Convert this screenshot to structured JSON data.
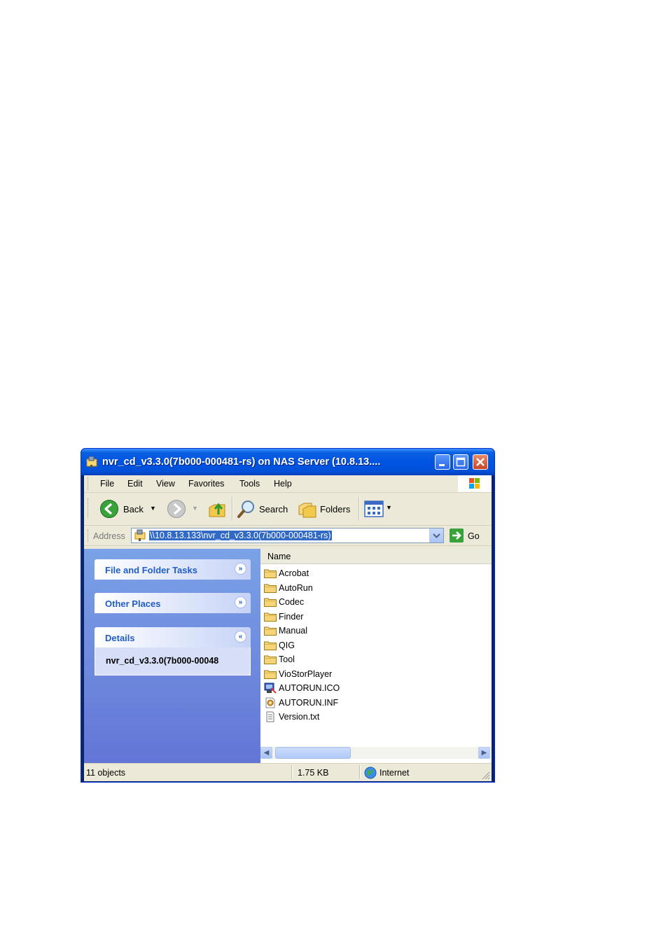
{
  "window": {
    "title": "nvr_cd_v3.3.0(7b000-000481-rs) on NAS Server (10.8.13....",
    "colors": {
      "titlebar": "#0054e3",
      "close_button": "#c8462a",
      "selection": "#316ac5"
    }
  },
  "menu": {
    "items": [
      "File",
      "Edit",
      "View",
      "Favorites",
      "Tools",
      "Help"
    ]
  },
  "toolbar": {
    "back_label": "Back",
    "search_label": "Search",
    "folders_label": "Folders",
    "icons": [
      "back-icon",
      "forward-icon",
      "up-folder-icon",
      "search-icon",
      "folders-icon",
      "views-icon"
    ]
  },
  "address": {
    "label": "Address",
    "value": "\\\\10.8.13.133\\nvr_cd_v3.3.0(7b000-000481-rs)",
    "go_label": "Go"
  },
  "taskpane": {
    "file_folder_tasks": "File and Folder Tasks",
    "other_places": "Other Places",
    "details": "Details",
    "details_name": "nvr_cd_v3.3.0(7b000-00048"
  },
  "list": {
    "column_name": "Name",
    "files": [
      {
        "name": "Acrobat",
        "icon": "folder-icon"
      },
      {
        "name": "AutoRun",
        "icon": "folder-icon"
      },
      {
        "name": "Codec",
        "icon": "folder-icon"
      },
      {
        "name": "Finder",
        "icon": "folder-icon"
      },
      {
        "name": "Manual",
        "icon": "folder-icon"
      },
      {
        "name": "QIG",
        "icon": "folder-icon"
      },
      {
        "name": "Tool",
        "icon": "folder-icon"
      },
      {
        "name": "VioStorPlayer",
        "icon": "folder-icon"
      },
      {
        "name": "AUTORUN.ICO",
        "icon": "ico-file-icon"
      },
      {
        "name": "AUTORUN.INF",
        "icon": "inf-file-icon"
      },
      {
        "name": "Version.txt",
        "icon": "text-file-icon"
      }
    ]
  },
  "status": {
    "objects": "11 objects",
    "size": "1.75 KB",
    "zone": "Internet"
  }
}
